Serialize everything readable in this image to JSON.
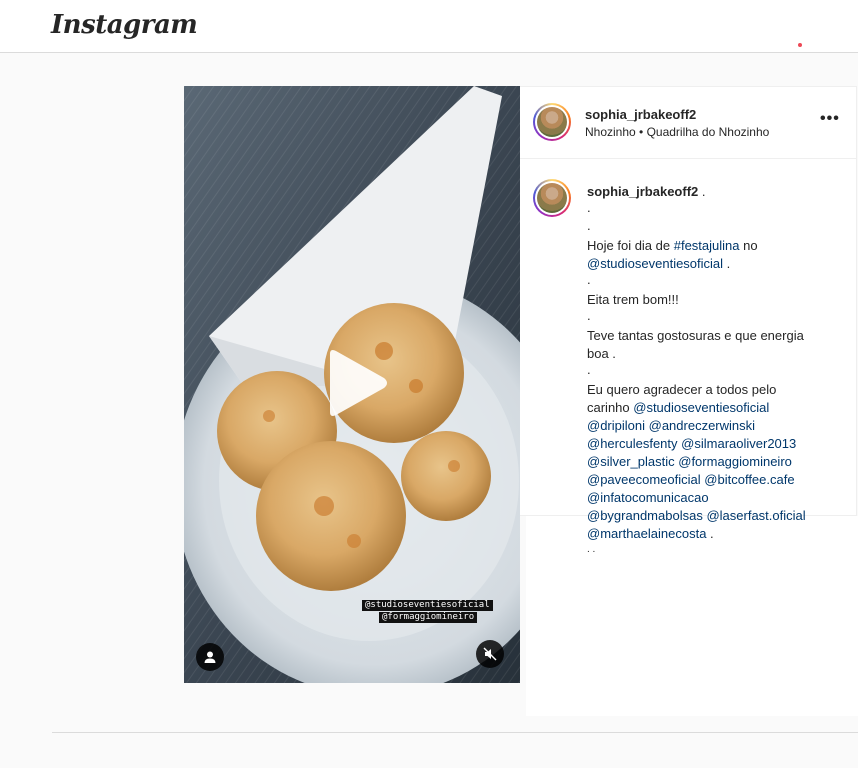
{
  "app": {
    "logo_text": "Instagram"
  },
  "post": {
    "username": "sophia_jrbakeoff2",
    "location": "Nhozinho • Quadrilha do Nhozinho",
    "media": {
      "type": "video",
      "stickers": [
        "@studioseventiesoficial",
        "@formaggiomineiro"
      ],
      "controls": [
        "play-icon",
        "user-tag-icon",
        "mute-icon"
      ]
    },
    "caption": {
      "author": "sophia_jrbakeoff2",
      "author_suffix": " .",
      "dot": ".",
      "line_hoje_prefix": "Hoje foi dia de ",
      "hashtag_festajulina": "#festajulina",
      "line_hoje_suffix": " no",
      "mention_studio": "@studioseventiesoficial",
      "sep_dot": " .",
      "line_eita": "Eita trem bom!!!",
      "line_teve_1": "Teve tantas gostosuras e que energia",
      "line_teve_2": "boa .",
      "line_agradecer": "Eu quero agradecer a todos pelo",
      "line_carinho": "carinho ",
      "mentions": {
        "studio": "@studioseventiesoficial",
        "dripiloni": "@dripiloni",
        "andreczerwinski": "@andreczerwinski",
        "herculesfenty": "@herculesfenty",
        "silmaraoliver2013": "@silmaraoliver2013",
        "silver_plastic": "@silver_plastic",
        "formaggiomineiro": "@formaggiomineiro",
        "paveecomeoficial": "@paveecomeoficial",
        "bitcoffee": "@bitcoffee.cafe",
        "infatocomunicacao": "@infatocomunicacao",
        "bygrandmabolsas": "@bygrandmabolsas",
        "laserfast": "@laserfast.oficial",
        "marthaelainecosta": "@marthaelainecosta"
      },
      "trailing": " .",
      "last_fragment": ". ."
    }
  },
  "colors": {
    "link": "#00376b",
    "text": "#262626",
    "notification": "#ed4956",
    "border": "#dbdbdb"
  }
}
